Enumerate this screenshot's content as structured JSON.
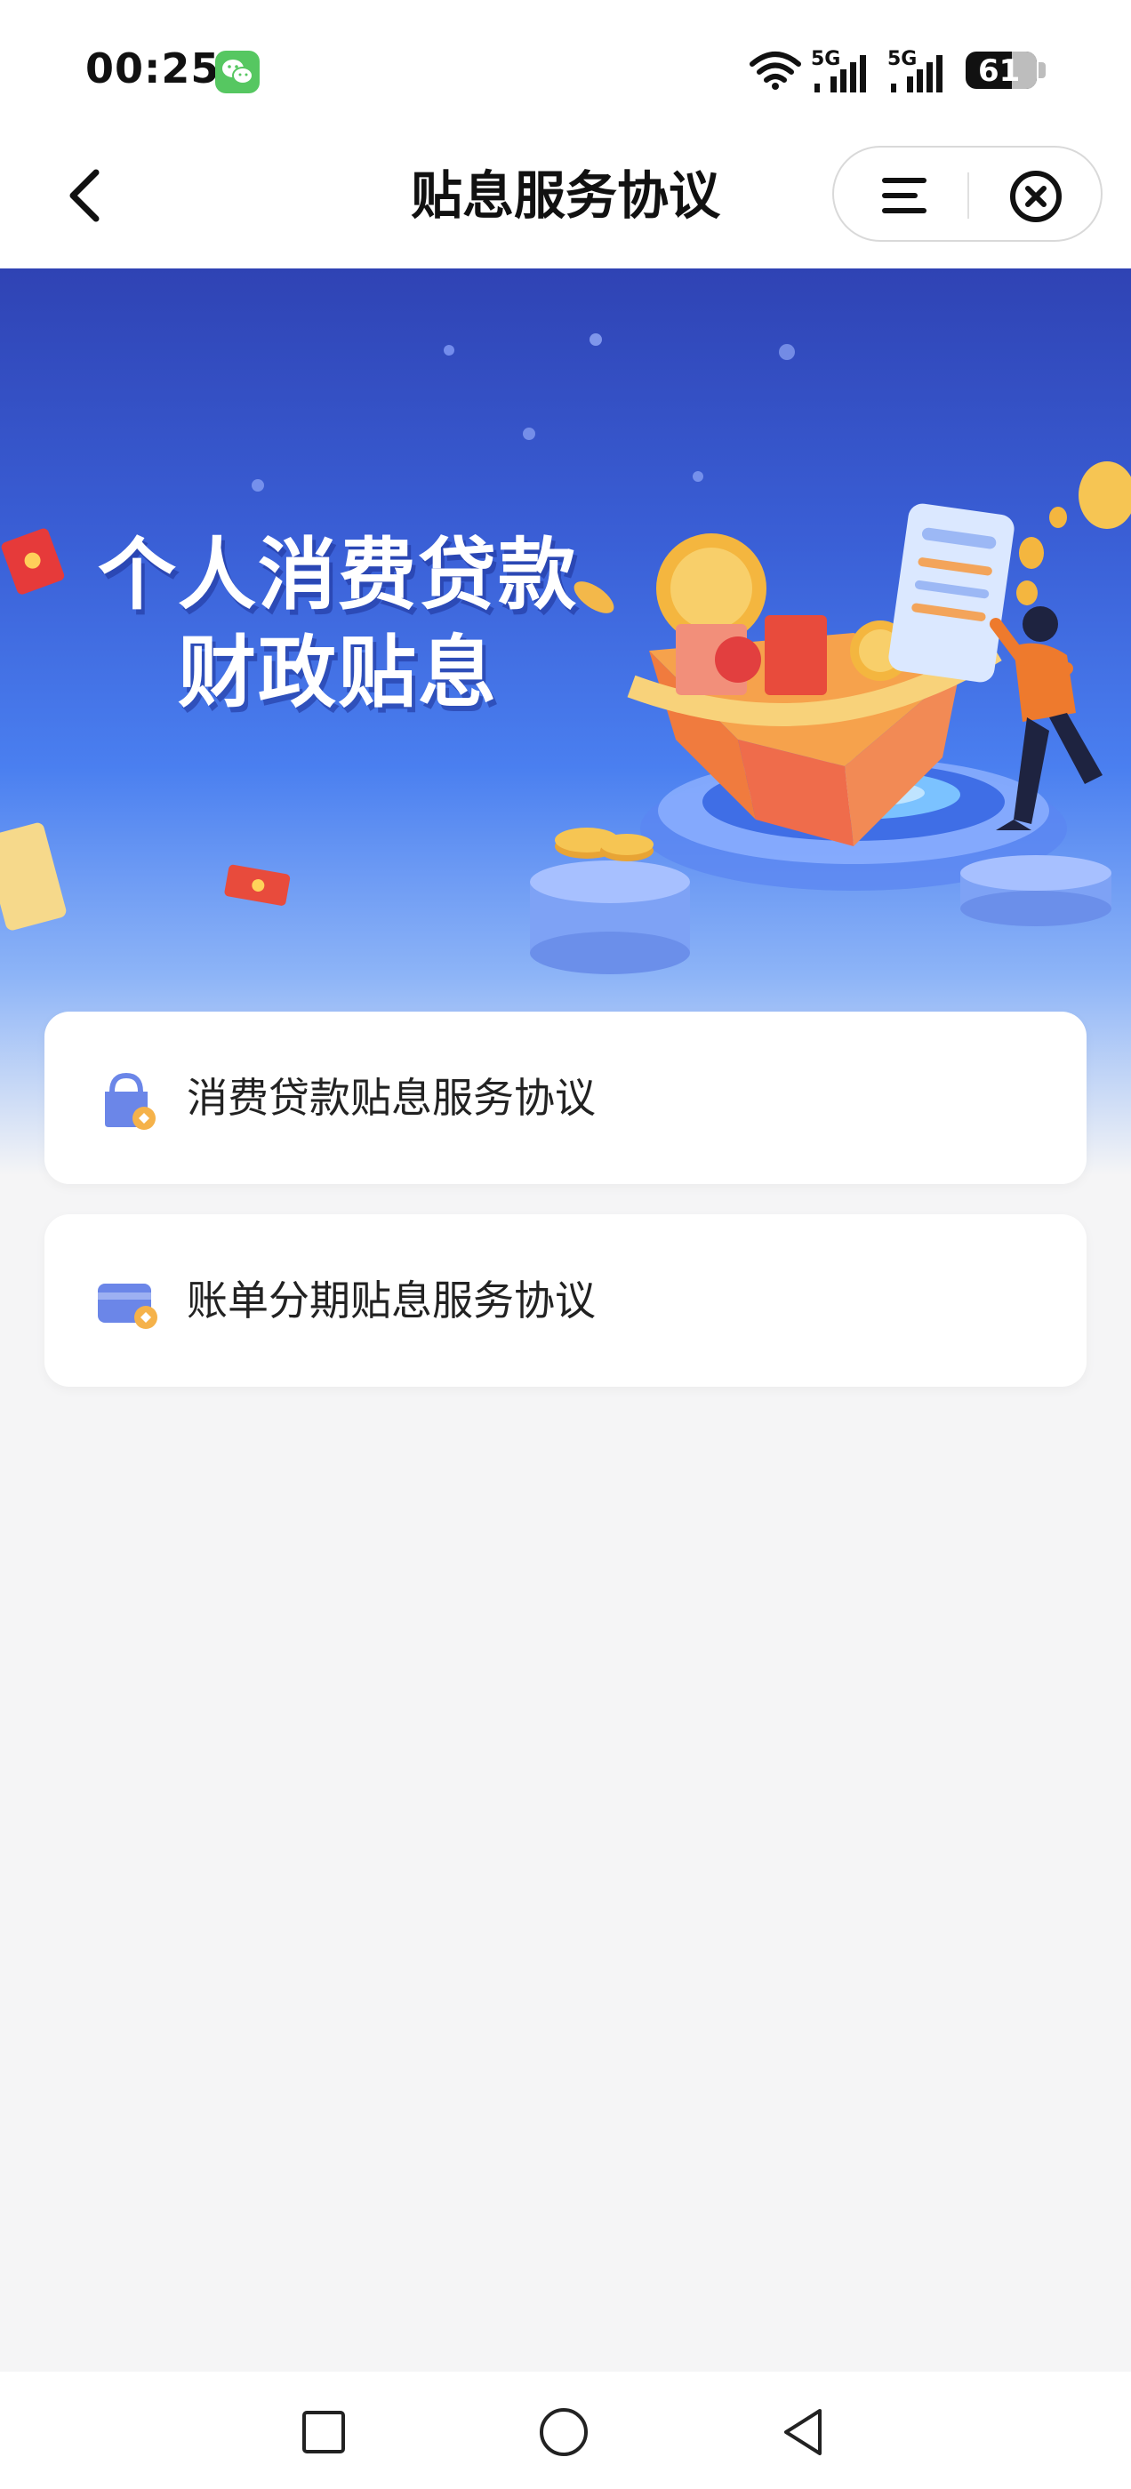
{
  "status_bar": {
    "time": "00:25",
    "signal_1": "5G",
    "signal_2": "5G",
    "battery_level": "61"
  },
  "nav": {
    "title": "贴息服务协议",
    "back_icon": "chevron-left-icon",
    "menu_icon": "menu-icon",
    "close_icon": "close-circle-icon"
  },
  "banner": {
    "line1": "个人消费贷款",
    "line2": "财政贴息"
  },
  "agreements": [
    {
      "label": "消费贷款贴息服务协议",
      "icon": "bag-icon"
    },
    {
      "label": "账单分期贴息服务协议",
      "icon": "card-icon"
    }
  ],
  "system_nav": {
    "recent_icon": "square-icon",
    "home_icon": "circle-icon",
    "back_icon": "triangle-back-icon"
  },
  "colors": {
    "banner_top": "#2f43b4",
    "banner_mid": "#4a7ff0",
    "page_bg": "#f5f5f6",
    "icon_blue": "#6b86e8",
    "icon_orange": "#f5b24a"
  }
}
